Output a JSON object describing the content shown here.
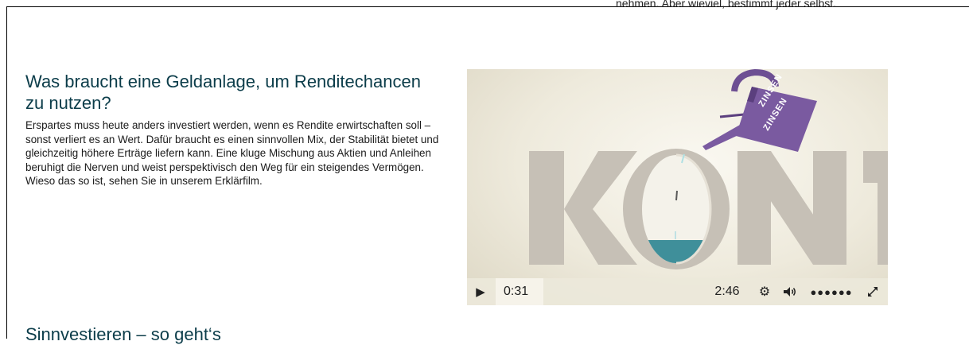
{
  "top_text": "nehmen. Aber wieviel, bestimmt jeder selbst.",
  "section": {
    "title": "Was braucht eine Geldanlage, um Renditechancen zu nutzen?",
    "body": "Erspartes muss heute anders investiert werden, wenn es Rendite erwirtschaften soll – sonst verliert es an Wert. Dafür braucht es einen sinnvollen Mix, der Stabilität bietet und gleichzeitig höhere Erträge liefern kann. Eine kluge Mischung aus Aktien und Anleihen beruhigt die Nerven und weist perspektivisch den Weg für ein steigendes Vermögen. Wieso das so ist, sehen Sie in unserem Erklärfilm."
  },
  "video": {
    "can_label": "ZINSEN",
    "word": "KONT",
    "time_current": "0:31",
    "time_total": "2:46",
    "progress_fraction": 0.187,
    "icons": {
      "play": "play-icon",
      "settings": "gear-icon",
      "volume": "speaker-icon",
      "volume_level": "volume-dots-icon",
      "fullscreen": "expand-icon"
    }
  },
  "next_section": {
    "title": "Sinnvestieren – so geht‘s"
  },
  "colors": {
    "heading": "#0c3d4a",
    "can": "#7a5aa0",
    "water": "#3f8f9a"
  }
}
